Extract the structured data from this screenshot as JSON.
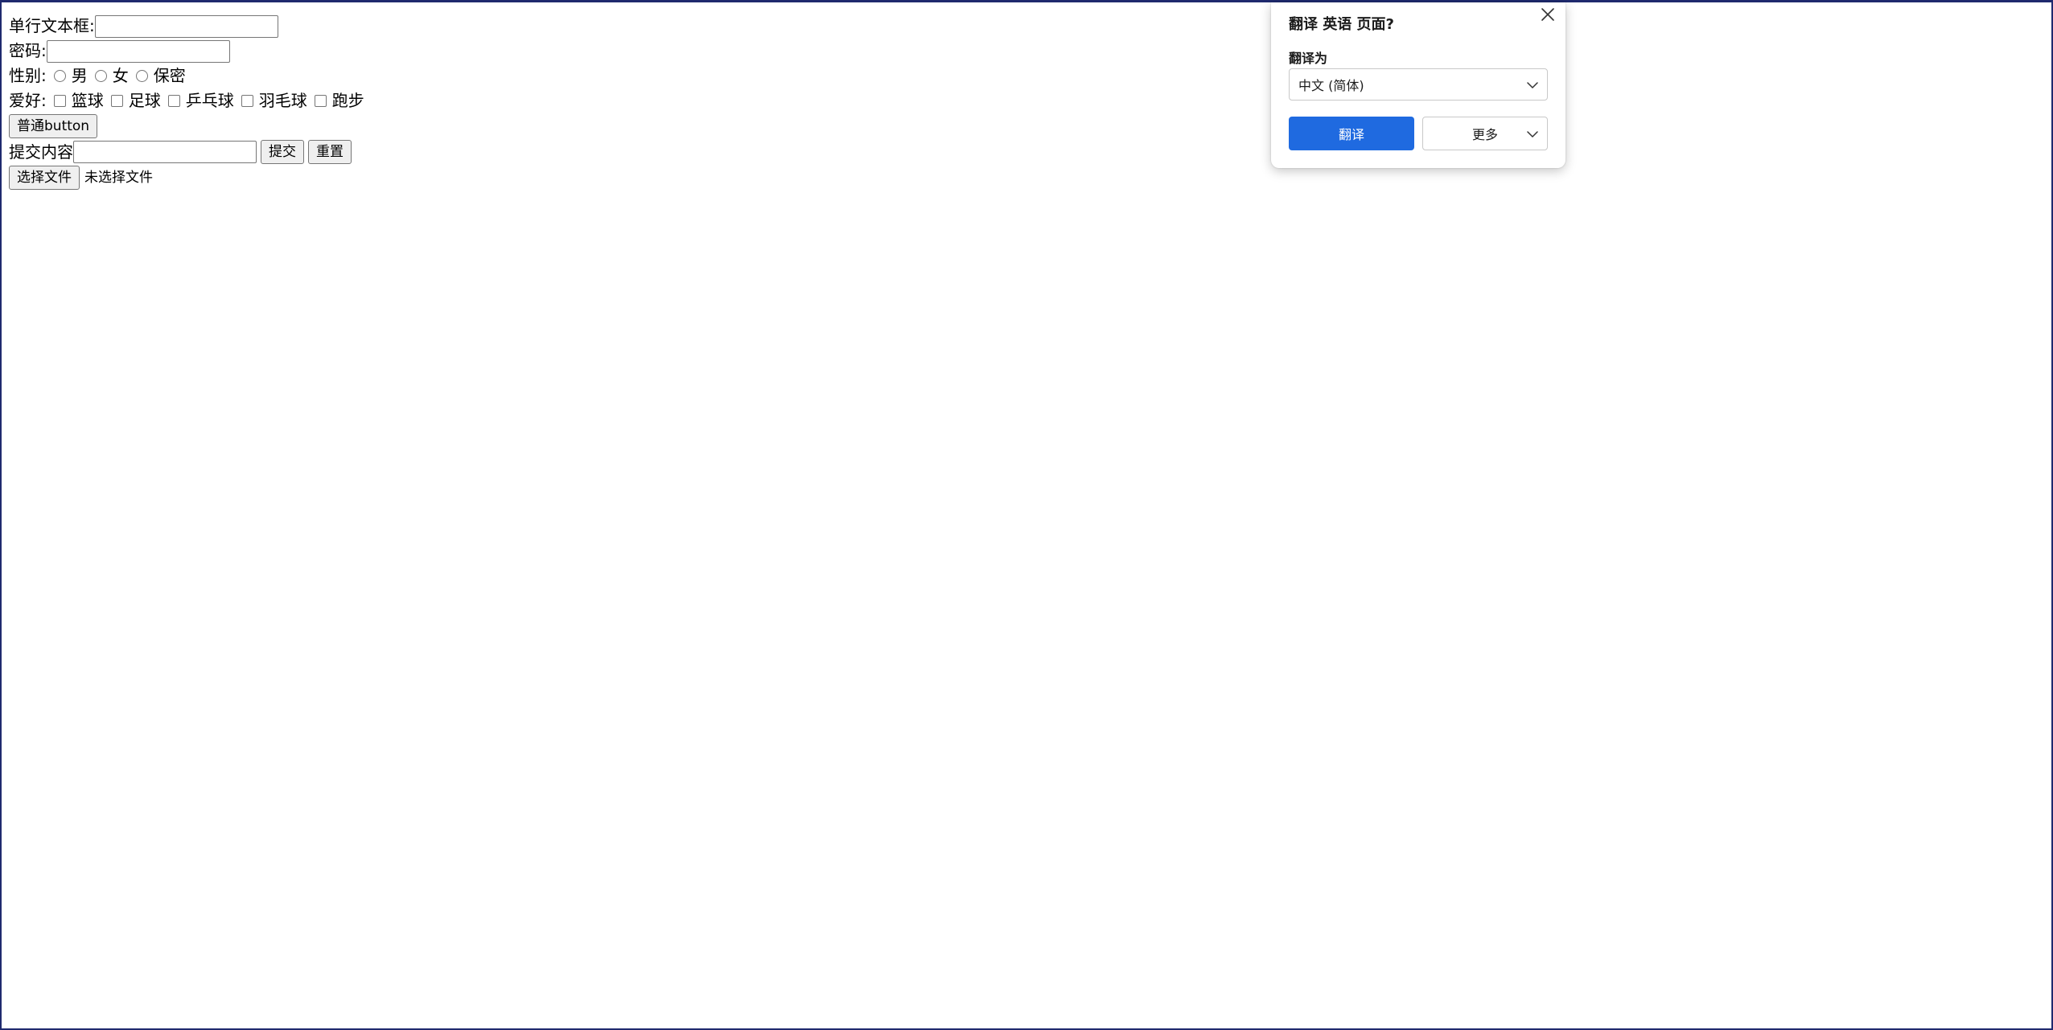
{
  "form": {
    "text_label": "单行文本框:",
    "text_value": "",
    "password_label": "密码:",
    "password_value": "",
    "gender_label": "性别:",
    "gender_options": [
      "男",
      "女",
      "保密"
    ],
    "hobby_label": "爱好:",
    "hobby_options": [
      "篮球",
      "足球",
      "乒乓球",
      "羽毛球",
      "跑步"
    ],
    "normal_button_label": "普通button",
    "submit_content_label": "提交内容",
    "submit_content_value": "",
    "submit_label": "提交",
    "reset_label": "重置",
    "file_button_label": "选择文件",
    "file_status": "未选择文件"
  },
  "translate_popup": {
    "title": "翻译 英语 页面?",
    "target_label": "翻译为",
    "selected_language": "中文 (简体)",
    "translate_label": "翻译",
    "more_label": "更多",
    "primary_color": "#1f6ae0",
    "close_icon": "close-icon"
  }
}
